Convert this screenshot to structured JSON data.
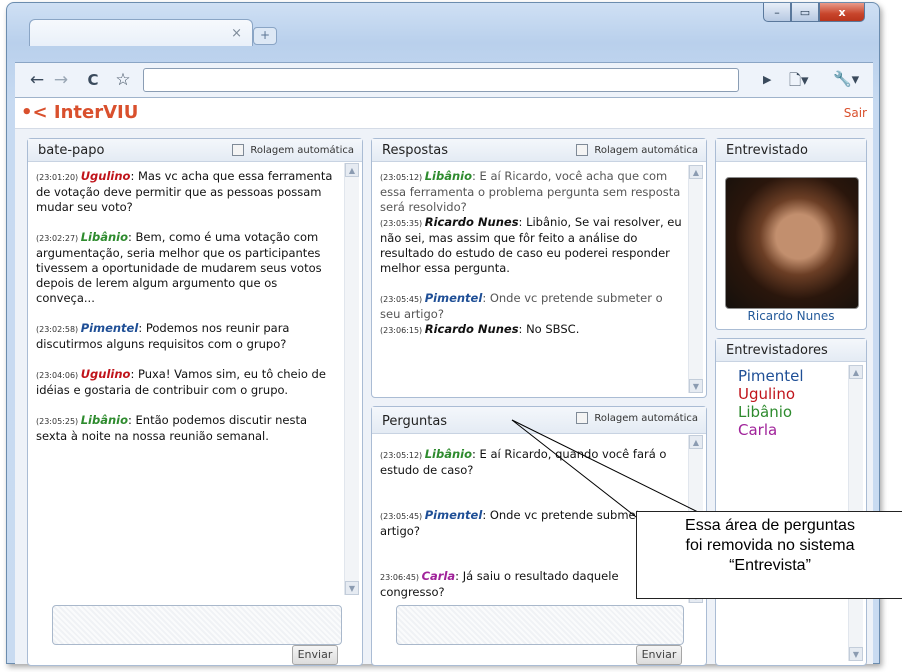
{
  "browser": {
    "tab_close": "×",
    "new_tab": "+",
    "back": "←",
    "forward": "→",
    "reload": "C",
    "star": "☆",
    "go": "▶",
    "page_menu": "🗋▾",
    "tools_menu": "🔧▾",
    "win_min": "–",
    "win_max": "▭",
    "win_close": "x"
  },
  "app": {
    "logo": "InterVIU",
    "logout": "Sair"
  },
  "chat": {
    "title": "bate-papo",
    "auto_scroll": "Rolagem automática",
    "send": "Enviar",
    "messages": [
      {
        "time": "(23:01:20)",
        "name": "Ugulino",
        "text": ": Mas vc acha que essa ferramenta de votação deve permitir que as pessoas possam mudar seu voto?"
      },
      {
        "time": "(23:02:27)",
        "name": "Libânio",
        "text": ": Bem, como é uma votação com argumentação, seria melhor que os participantes tivessem a oportunidade de mudarem seus votos depois de lerem algum argumento que os conveça..."
      },
      {
        "time": "(23:02:58)",
        "name": "Pimentel",
        "text": ": Podemos nos reunir para discutirmos alguns requisitos com o grupo?"
      },
      {
        "time": "(23:04:06)",
        "name": "Ugulino",
        "text": ": Puxa! Vamos sim, eu tô cheio de idéias e gostaria de contribuir com o grupo."
      },
      {
        "time": "(23:05:25)",
        "name": "Libânio",
        "text": ": Então podemos discutir nesta sexta à noite na nossa reunião semanal."
      }
    ]
  },
  "answers": {
    "title": "Respostas",
    "auto_scroll": "Rolagem automática",
    "messages": [
      {
        "time": "(23:05:12)",
        "name": "Libânio",
        "text": ": E aí Ricardo, você acha que com essa ferramenta o problema pergunta sem resposta será resolvido?"
      },
      {
        "time": "(23:05:35)",
        "name": "Ricardo Nunes",
        "text": ": Libânio, Se vai resolver, eu não sei, mas assim que fôr feito a análise do resultado do estudo de caso eu poderei responder melhor essa pergunta."
      },
      {
        "time": "(23:05:45)",
        "name": "Pimentel",
        "text": ": Onde vc pretende submeter o seu artigo?"
      },
      {
        "time": "(23:06:15)",
        "name": "Ricardo Nunes",
        "text": ": No SBSC."
      }
    ]
  },
  "questions": {
    "title": "Perguntas",
    "auto_scroll": "Rolagem automática",
    "send": "Enviar",
    "messages": [
      {
        "time": "(23:05:12)",
        "name": "Libânio",
        "text": ": E aí Ricardo, quando você fará o estudo de caso?"
      },
      {
        "time": "(23:05:45)",
        "name": "Pimentel",
        "text": ": Onde vc pretende submeter seu artigo?"
      },
      {
        "time": "23:06:45)",
        "name": "Carla",
        "text": ": Já saiu o resultado daquele congresso?"
      }
    ]
  },
  "interviewee": {
    "title": "Entrevistado",
    "name": "Ricardo Nunes"
  },
  "interviewers": {
    "title": "Entrevistadores",
    "list": [
      "Pimentel",
      "Ugulino",
      "Libânio",
      "Carla"
    ]
  },
  "colors": {
    "Ugulino": "#c0141b",
    "Libânio": "#2e8b2e",
    "Pimentel": "#1f4f96",
    "Carla": "#a0229a",
    "Ricardo Nunes": "#111111",
    "accent": "#d9502d"
  },
  "annotation": {
    "line1": "Essa área de perguntas",
    "line2": "foi removida no sistema",
    "line3": "“Entrevista”"
  }
}
